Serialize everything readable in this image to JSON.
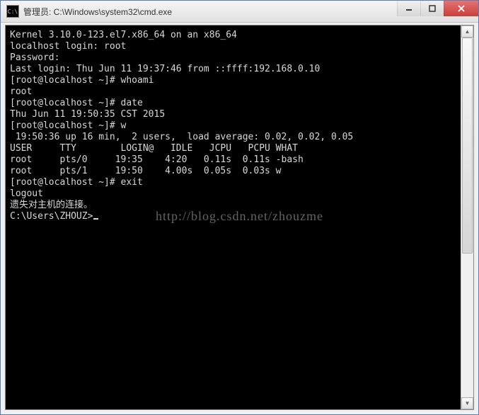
{
  "titlebar": {
    "icon_label": "C:\\",
    "text": "管理员: C:\\Windows\\system32\\cmd.exe"
  },
  "terminal": {
    "lines": [
      "Kernel 3.10.0-123.el7.x86_64 on an x86_64",
      "localhost login: root",
      "Password:",
      "Last login: Thu Jun 11 19:37:46 from ::ffff:192.168.0.10",
      "[root@localhost ~]# whoami",
      "root",
      "[root@localhost ~]# date",
      "Thu Jun 11 19:50:35 CST 2015",
      "[root@localhost ~]# w",
      " 19:50:36 up 16 min,  2 users,  load average: 0.02, 0.02, 0.05",
      "USER     TTY        LOGIN@   IDLE   JCPU   PCPU WHAT",
      "root     pts/0     19:35    4:20   0.11s  0.11s -bash",
      "root     pts/1     19:50    4.00s  0.05s  0.03s w",
      "[root@localhost ~]# exit",
      "logout",
      "",
      "遗失对主机的连接。",
      "",
      "C:\\Users\\ZHOUZ>"
    ]
  },
  "watermark": "http://blog.csdn.net/zhouzme"
}
